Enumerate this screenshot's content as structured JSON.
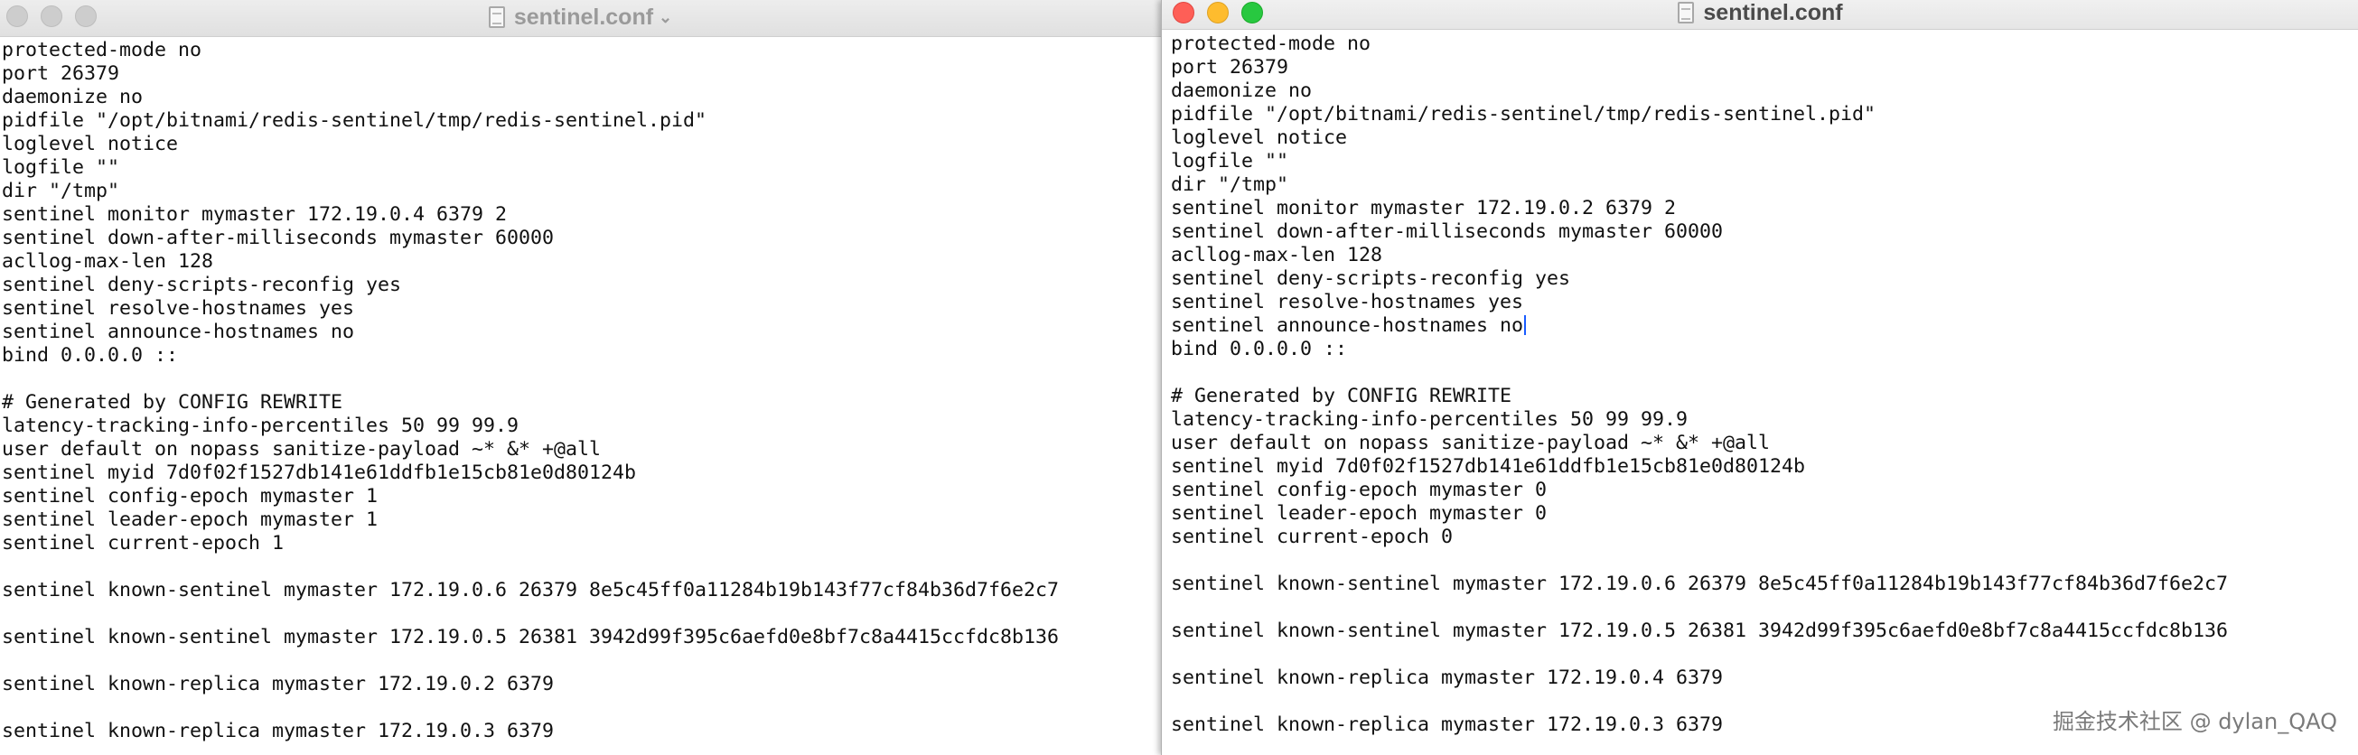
{
  "left_window": {
    "title": "sentinel.conf",
    "lines": [
      "protected-mode no",
      "port 26379",
      "daemonize no",
      "pidfile \"/opt/bitnami/redis-sentinel/tmp/redis-sentinel.pid\"",
      "loglevel notice",
      "logfile \"\"",
      "dir \"/tmp\"",
      "sentinel monitor mymaster 172.19.0.4 6379 2",
      "sentinel down-after-milliseconds mymaster 60000",
      "acllog-max-len 128",
      "sentinel deny-scripts-reconfig yes",
      "sentinel resolve-hostnames yes",
      "sentinel announce-hostnames no",
      "bind 0.0.0.0 ::",
      "",
      "# Generated by CONFIG REWRITE",
      "latency-tracking-info-percentiles 50 99 99.9",
      "user default on nopass sanitize-payload ~* &* +@all",
      "sentinel myid 7d0f02f1527db141e61ddfb1e15cb81e0d80124b",
      "sentinel config-epoch mymaster 1",
      "sentinel leader-epoch mymaster 1",
      "sentinel current-epoch 1",
      "",
      "sentinel known-sentinel mymaster 172.19.0.6 26379 8e5c45ff0a11284b19b143f77cf84b36d7f6e2c7",
      "",
      "sentinel known-sentinel mymaster 172.19.0.5 26381 3942d99f395c6aefd0e8bf7c8a4415ccfdc8b136",
      "",
      "sentinel known-replica mymaster 172.19.0.2 6379",
      "",
      "sentinel known-replica mymaster 172.19.0.3 6379"
    ]
  },
  "right_window": {
    "title": "sentinel.conf",
    "lines": [
      "protected-mode no",
      "port 26379",
      "daemonize no",
      "pidfile \"/opt/bitnami/redis-sentinel/tmp/redis-sentinel.pid\"",
      "loglevel notice",
      "logfile \"\"",
      "dir \"/tmp\"",
      "sentinel monitor mymaster 172.19.0.2 6379 2",
      "sentinel down-after-milliseconds mymaster 60000",
      "acllog-max-len 128",
      "sentinel deny-scripts-reconfig yes",
      "sentinel resolve-hostnames yes",
      "sentinel announce-hostnames no",
      "bind 0.0.0.0 ::",
      "",
      "# Generated by CONFIG REWRITE",
      "latency-tracking-info-percentiles 50 99 99.9",
      "user default on nopass sanitize-payload ~* &* +@all",
      "sentinel myid 7d0f02f1527db141e61ddfb1e15cb81e0d80124b",
      "sentinel config-epoch mymaster 0",
      "sentinel leader-epoch mymaster 0",
      "sentinel current-epoch 0",
      "",
      "sentinel known-sentinel mymaster 172.19.0.6 26379 8e5c45ff0a11284b19b143f77cf84b36d7f6e2c7",
      "",
      "sentinel known-sentinel mymaster 172.19.0.5 26381 3942d99f395c6aefd0e8bf7c8a4415ccfdc8b136",
      "",
      "sentinel known-replica mymaster 172.19.0.4 6379",
      "",
      "sentinel known-replica mymaster 172.19.0.3 6379"
    ]
  },
  "watermark": "掘金技术社区 @ dylan_QAQ",
  "colors": {
    "close": "#fe5f57",
    "minimize": "#febc2e",
    "zoom": "#28c840",
    "caret": "#1a5cff"
  }
}
